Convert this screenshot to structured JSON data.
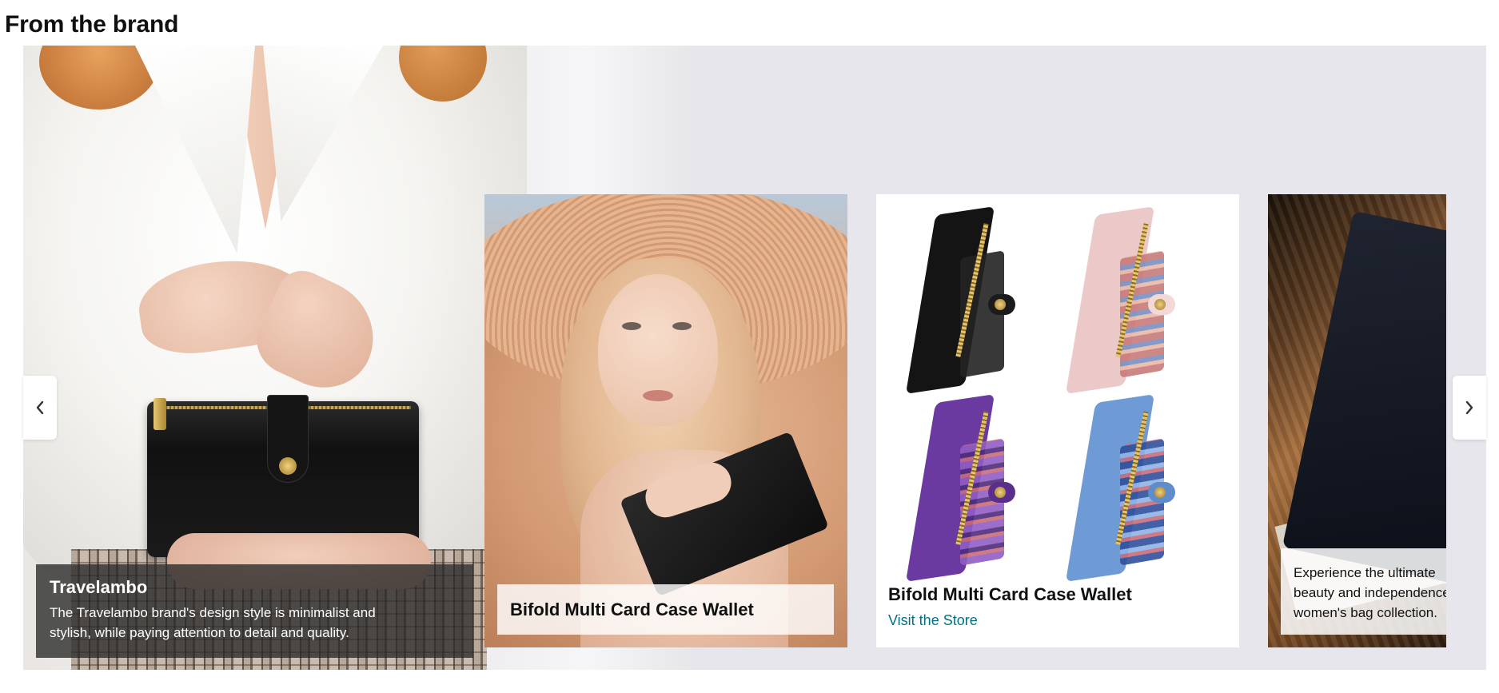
{
  "section": {
    "title": "From the brand"
  },
  "carousel": {
    "hero": {
      "title": "Travelambo",
      "description_line1": "The Travelambo brand's design style is minimalist and",
      "description_line2": "stylish, while paying attention to detail and quality."
    },
    "cards": [
      {
        "title": "Bifold Multi Card Case Wallet"
      },
      {
        "title": "Bifold Multi Card Case Wallet",
        "link": "Visit the Store",
        "link_color": "#007185",
        "wallet_colors": [
          "#111111",
          "#ecc9c9",
          "#6a3aa0",
          "#6e9bd6"
        ]
      },
      {
        "caption": "Experience the ultimate\nbeauty and independence\nwomen's bag collection."
      }
    ],
    "prev_icon": "chevron-left-icon",
    "next_icon": "chevron-right-icon"
  }
}
